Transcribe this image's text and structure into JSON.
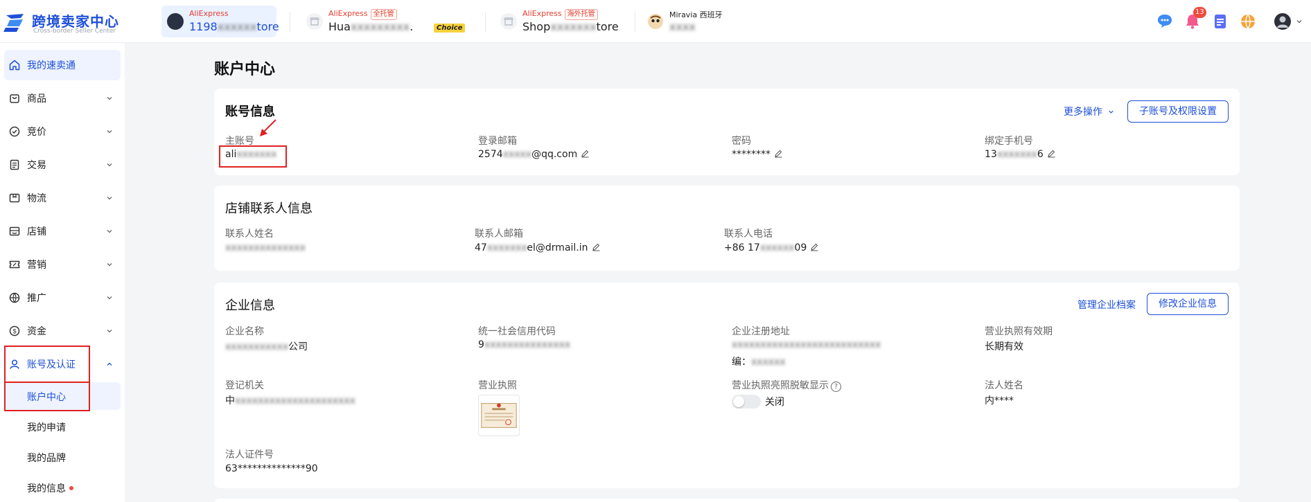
{
  "colors": {
    "primary": "#1d4fd8",
    "brand_red": "#e43d30",
    "badge_red": "#f04a3e",
    "highlight_box": "#e02020"
  },
  "header": {
    "logo": {
      "title": "跨境卖家中心",
      "subtitle": "Cross-border Seller Center"
    },
    "stores": [
      {
        "brand": "AliExpress",
        "tag": "",
        "name_visible": "1198",
        "name_blurred": "xxxxxx",
        "name_suffix": "tore"
      },
      {
        "brand": "AliExpress",
        "tag": "全托管",
        "name_visible": "Hua",
        "name_blurred": "xxxxxxxxx",
        "name_suffix": ".",
        "badge": "Choice"
      },
      {
        "brand": "AliExpress",
        "tag": "海外托管",
        "name_visible": "Shop",
        "name_blurred": "xxxxxxx",
        "name_suffix": "tore"
      },
      {
        "brand": "Miravia",
        "tag": "西班牙",
        "name_visible": "",
        "name_blurred": "xxxx",
        "name_suffix": ""
      }
    ],
    "notification_count": "13",
    "icons": [
      "chat-icon",
      "bell-icon",
      "clipboard-icon",
      "globe-icon",
      "user-avatar"
    ]
  },
  "sidebar": {
    "items": [
      {
        "label": "我的速卖通",
        "icon": "home-icon"
      },
      {
        "label": "商品",
        "icon": "bag-icon"
      },
      {
        "label": "竞价",
        "icon": "bid-icon"
      },
      {
        "label": "交易",
        "icon": "receipt-icon"
      },
      {
        "label": "物流",
        "icon": "box-icon"
      },
      {
        "label": "店铺",
        "icon": "shop-icon"
      },
      {
        "label": "营销",
        "icon": "coupon-icon"
      },
      {
        "label": "推广",
        "icon": "globe-icon"
      },
      {
        "label": "资金",
        "icon": "dollar-icon"
      },
      {
        "label": "账号及认证",
        "icon": "user-icon"
      }
    ],
    "subitems": [
      {
        "label": "账户中心"
      },
      {
        "label": "我的申请"
      },
      {
        "label": "我的品牌"
      },
      {
        "label": "我的信息"
      }
    ]
  },
  "main": {
    "title": "账户中心",
    "account_info": {
      "title": "账号信息",
      "more_actions": "更多操作",
      "sub_account_button": "子账号及权限设置",
      "fields": [
        {
          "label": "主账号",
          "value_visible": "ali",
          "value_blurred": "xxxxxxx"
        },
        {
          "label": "登录邮箱",
          "value_visible": "2574",
          "value_blurred": "xxxxx",
          "value_suffix": "@qq.com"
        },
        {
          "label": "密码",
          "value_visible": "********",
          "value_blurred": "",
          "value_suffix": ""
        },
        {
          "label": "绑定手机号",
          "value_visible": "13",
          "value_blurred": "xxxxxxx",
          "value_suffix": "6"
        }
      ]
    },
    "contact_info": {
      "title": "店铺联系人信息",
      "fields": [
        {
          "label": "联系人姓名",
          "value_visible": "",
          "value_blurred": "xxxxxxxxxxxxxx",
          "value_suffix": ""
        },
        {
          "label": "联系人邮箱",
          "value_visible": "47",
          "value_blurred": "xxxxxxx",
          "value_suffix": "el@drmail.in"
        },
        {
          "label": "联系人电话",
          "value_visible": "+86 17",
          "value_blurred": "xxxxxx",
          "value_suffix": "09"
        }
      ]
    },
    "company_info": {
      "title": "企业信息",
      "manage_link": "管理企业档案",
      "edit_button": "修改企业信息",
      "fields": {
        "name": {
          "label": "企业名称",
          "value_blurred": "xxxxxxxxxxx",
          "value_suffix": "公司"
        },
        "credit_code": {
          "label": "统一社会信用代码",
          "value_visible": "9",
          "value_blurred": "xxxxxxxxxxxxxxx",
          "value_suffix": ""
        },
        "address": {
          "label": "企业注册地址",
          "value_blurred": "xxxxxxxxxxxxxxxxxxxxxxxxxx",
          "value_line2_visible": "编：",
          "value_line2_blurred": "xxxxxx"
        },
        "license_validity": {
          "label": "营业执照有效期",
          "value": "长期有效"
        },
        "registration_authority": {
          "label": "登记机关",
          "value_visible": "中",
          "value_blurred": "xxxxxxxxxxxxxxxxxxxxx"
        },
        "license": {
          "label": "营业执照"
        },
        "desensitize": {
          "label": "营业执照亮照脱敏显示",
          "help": "?",
          "toggle_label": "关闭"
        },
        "legal_name": {
          "label": "法人姓名",
          "value": "内****"
        },
        "legal_id": {
          "label": "法人证件号",
          "value": "63**************90"
        }
      }
    }
  }
}
